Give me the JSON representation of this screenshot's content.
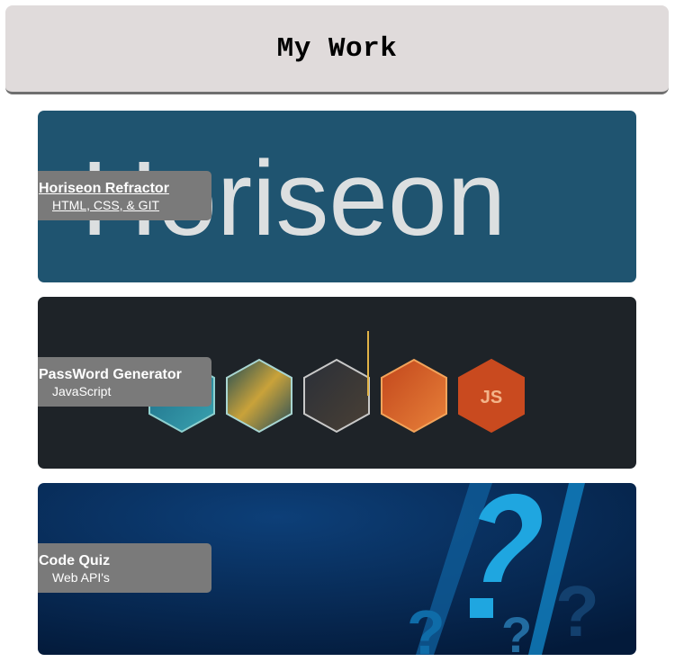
{
  "header": {
    "title": "My Work"
  },
  "projects": [
    {
      "title": "Horiseon Refractor",
      "subtitle": "HTML, CSS, & GIT",
      "image_text": "Horiseon",
      "bg_color": "#1f5470"
    },
    {
      "title": "PassWord Generator",
      "subtitle": "JavaScript",
      "image_text": "JS",
      "bg_color": "#1e2328"
    },
    {
      "title": "Code Quiz",
      "subtitle": "Web API's",
      "bg_color": "#062a55"
    }
  ]
}
